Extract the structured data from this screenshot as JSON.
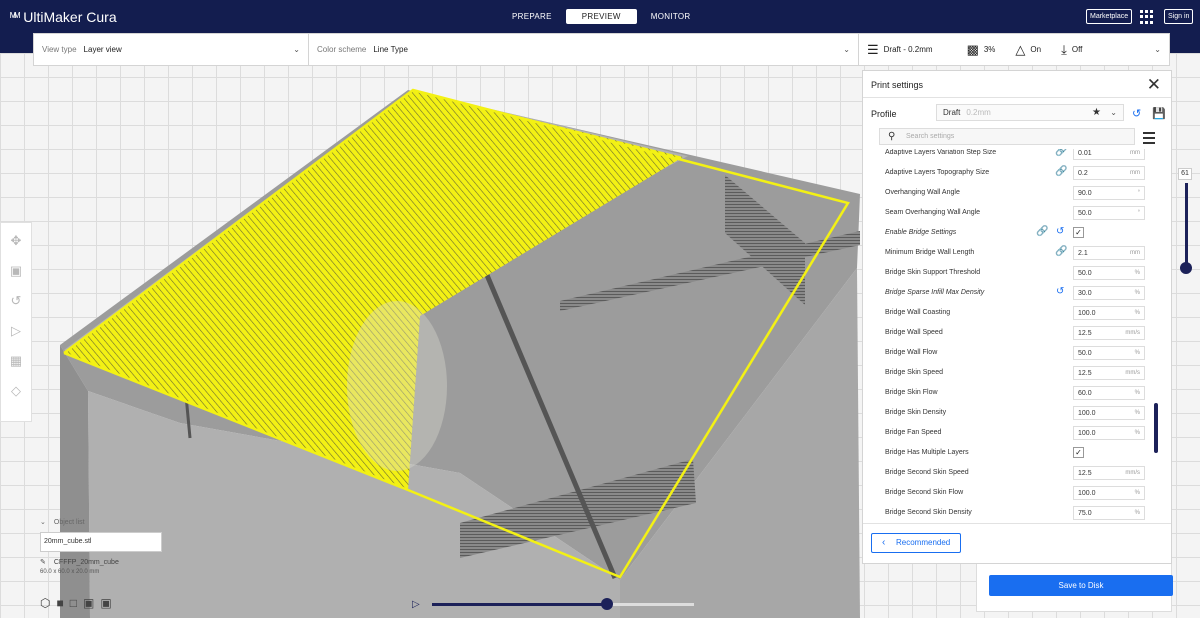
{
  "app": {
    "logo_mark": "ᴹᴹ",
    "title": "UltiMaker Cura"
  },
  "stages": [
    {
      "label": "PREPARE",
      "active": false
    },
    {
      "label": "PREVIEW",
      "active": true
    },
    {
      "label": "MONITOR",
      "active": false
    }
  ],
  "header": {
    "marketplace": "Marketplace",
    "signin": "Sign in"
  },
  "toolbar": {
    "view_type_label": "View type",
    "view_type_value": "Layer view",
    "color_scheme_label": "Color scheme",
    "color_scheme_value": "Line Type",
    "print_profile": "Draft - 0.2mm",
    "infill": "3%",
    "support": "On",
    "adhesion": "Off"
  },
  "print_settings": {
    "title": "Print settings",
    "profile_label": "Profile",
    "profile_value": "Draft",
    "profile_sub": "0.2mm",
    "search_placeholder": "Search settings",
    "recommended_label": "Recommended",
    "settings": [
      {
        "name": "Adaptive Layers Variation Step Size",
        "value": "0.01",
        "unit": "mm",
        "link": true
      },
      {
        "name": "Adaptive Layers Topography Size",
        "value": "0.2",
        "unit": "mm",
        "link": true
      },
      {
        "name": "Overhanging Wall Angle",
        "value": "90.0",
        "unit": "°"
      },
      {
        "name": "Seam Overhanging Wall Angle",
        "value": "50.0",
        "unit": "°"
      },
      {
        "name": "Enable Bridge Settings",
        "checkbox": true,
        "italic": true,
        "link": true,
        "reset": true
      },
      {
        "name": "Minimum Bridge Wall Length",
        "value": "2.1",
        "unit": "mm",
        "link": true
      },
      {
        "name": "Bridge Skin Support Threshold",
        "value": "50.0",
        "unit": "%"
      },
      {
        "name": "Bridge Sparse Infill Max Density",
        "value": "30.0",
        "unit": "%",
        "italic": true,
        "reset": true
      },
      {
        "name": "Bridge Wall Coasting",
        "value": "100.0",
        "unit": "%"
      },
      {
        "name": "Bridge Wall Speed",
        "value": "12.5",
        "unit": "mm/s"
      },
      {
        "name": "Bridge Wall Flow",
        "value": "50.0",
        "unit": "%"
      },
      {
        "name": "Bridge Skin Speed",
        "value": "12.5",
        "unit": "mm/s"
      },
      {
        "name": "Bridge Skin Flow",
        "value": "60.0",
        "unit": "%"
      },
      {
        "name": "Bridge Skin Density",
        "value": "100.0",
        "unit": "%"
      },
      {
        "name": "Bridge Fan Speed",
        "value": "100.0",
        "unit": "%"
      },
      {
        "name": "Bridge Has Multiple Layers",
        "checkbox": true
      },
      {
        "name": "Bridge Second Skin Speed",
        "value": "12.5",
        "unit": "mm/s"
      },
      {
        "name": "Bridge Second Skin Flow",
        "value": "100.0",
        "unit": "%"
      },
      {
        "name": "Bridge Second Skin Density",
        "value": "75.0",
        "unit": "%"
      }
    ]
  },
  "object_list": {
    "header": "Object list",
    "item": "20mm_cube.stl",
    "name": "CFFFP_20mm_cube",
    "dimensions": "60.0 x 60.0 x 20.0 mm"
  },
  "layer_slider": {
    "value": "61"
  },
  "save_button": "Save to Disk",
  "colors": {
    "header": "#131d4f",
    "accent": "#196ef0",
    "infill": "#f3f114"
  }
}
